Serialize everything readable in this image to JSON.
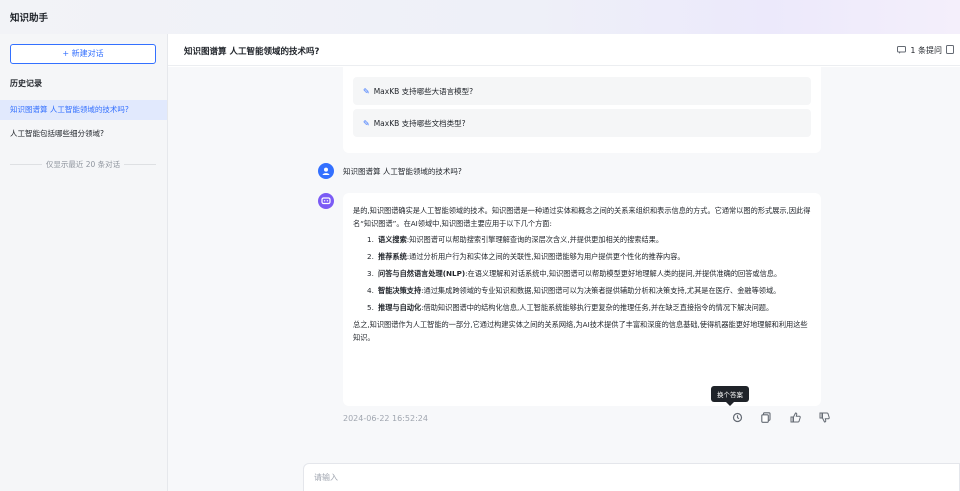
{
  "app": {
    "title": "知识助手"
  },
  "sidebar": {
    "new_chat_label": "+ 新建对话",
    "history_title": "历史记录",
    "items": [
      {
        "label": "知识图谱算 人工智能领域的技术吗?",
        "active": true
      },
      {
        "label": "人工智能包括哪些细分领域?",
        "active": false
      }
    ],
    "footer_note": "仅显示最近 20 条对话"
  },
  "header": {
    "title": "知识图谱算 人工智能领域的技术吗?",
    "count_label": "1 条提问"
  },
  "conversation": {
    "suggestions": [
      "MaxKB 支持哪些大语言模型?",
      "MaxKB 支持哪些文档类型?"
    ],
    "question": "知识图谱算 人工智能领域的技术吗?",
    "answer": {
      "intro": "是的,知识图谱确实是人工智能领域的技术。知识图谱是一种通过实体和概念之间的关系来组织和表示信息的方式。它通常以图的形式展示,因此得名“知识图谱”。在AI领域中,知识图谱主要应用于以下几个方面:",
      "points": [
        {
          "num": "1.",
          "title": "语义搜索",
          "text": ":知识图谱可以帮助搜索引擎理解查询的深层次含义,并提供更加相关的搜索结果。"
        },
        {
          "num": "2.",
          "title": "推荐系统",
          "text": ":通过分析用户行为和实体之间的关联性,知识图谱能够为用户提供更个性化的推荐内容。"
        },
        {
          "num": "3.",
          "title": "问答与自然语言处理(NLP)",
          "text": ":在语义理解和对话系统中,知识图谱可以帮助模型更好地理解人类的提问,并提供准确的回答或信息。"
        },
        {
          "num": "4.",
          "title": "智能决策支持",
          "text": ":通过集成跨领域的专业知识和数据,知识图谱可以为决策者提供辅助分析和决策支持,尤其是在医疗、金融等领域。"
        },
        {
          "num": "5.",
          "title": "推理与自动化",
          "text": ":借助知识图谱中的结构化信息,人工智能系统能够执行更复杂的推理任务,并在缺乏直接指令的情况下解决问题。"
        }
      ],
      "conclusion": "总之,知识图谱作为人工智能的一部分,它通过构建实体之间的关系网络,为AI技术提供了丰富和深度的信息基础,使得机器能更好地理解和利用这些知识。"
    },
    "timestamp": "2024-06-22 16:52:24",
    "tooltip": "换个答案"
  },
  "input": {
    "placeholder": "请输入"
  },
  "colors": {
    "accent": "#3370ff",
    "bot_avatar": "#7b5bf5",
    "active_bg": "#e1e9fd"
  }
}
